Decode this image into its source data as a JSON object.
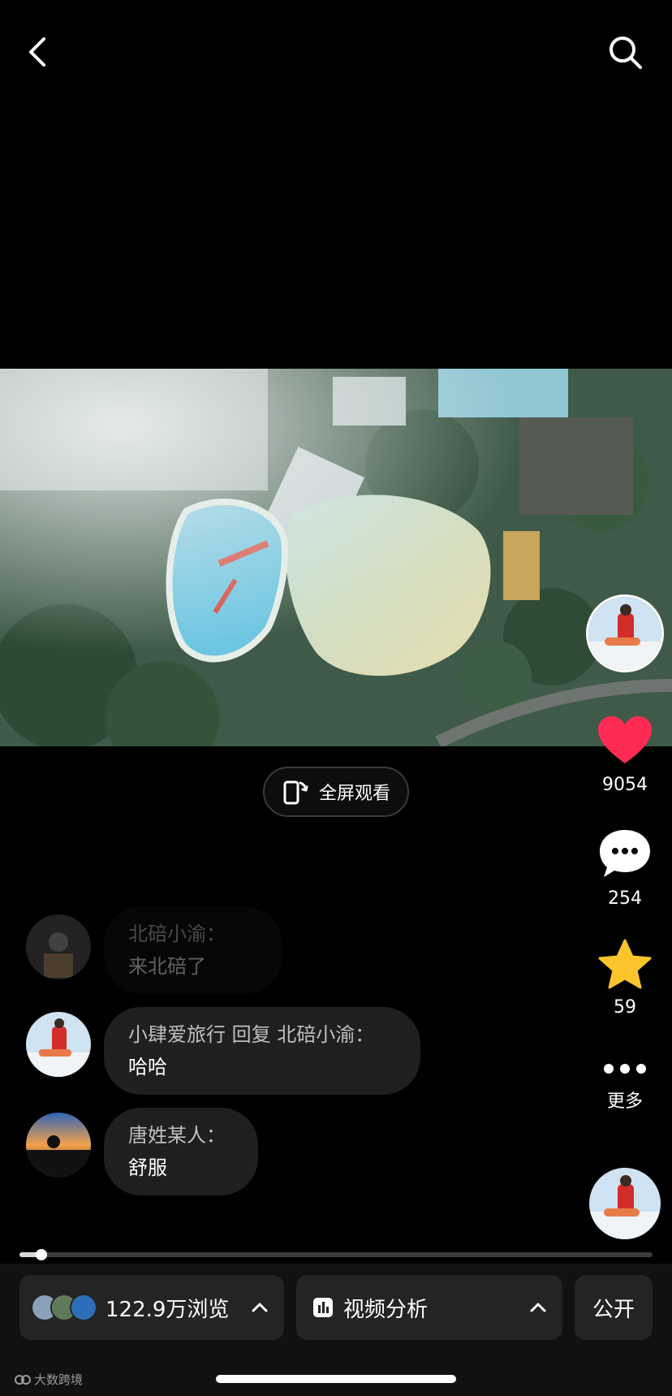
{
  "fullscreen_button": {
    "label": "全屏观看"
  },
  "actions": {
    "like_count": "9054",
    "comment_count": "254",
    "favorite_count": "59",
    "more_label": "更多"
  },
  "comments": [
    {
      "name": "北碚小渝：",
      "text": "来北碚了"
    },
    {
      "name": "小肆爱旅行 回复 北碚小渝：",
      "text": "哈哈"
    },
    {
      "name": "唐姓某人：",
      "text": "舒服"
    }
  ],
  "progress": {
    "fraction": 0.035
  },
  "bottom_bar": {
    "views_label": "122.9万浏览",
    "analysis_label": "视频分析",
    "visibility_label": "公开"
  },
  "watermark": "大数跨境",
  "colors": {
    "like": "#fe2c55",
    "favorite": "#fcc52c",
    "background": "#000000"
  },
  "icons": [
    "back-icon",
    "search-icon",
    "fullscreen-icon",
    "heart-icon",
    "comment-icon",
    "star-icon",
    "more-icon",
    "chart-icon",
    "chevron-up-icon"
  ]
}
